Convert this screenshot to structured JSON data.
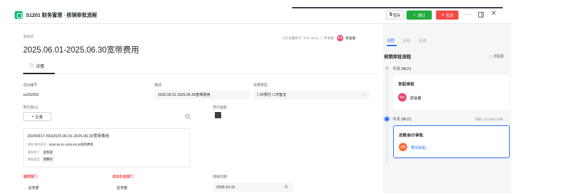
{
  "header": {
    "title": "S1201 财务管理 · 核销审批流程",
    "save_label": "暂存",
    "pass_label": "通过",
    "reject_label": "否决",
    "more_label": "···",
    "close_label": "✕"
  },
  "document": {
    "type_label": "报销单",
    "title": "2025.06.01-2025.06.30宽带费用",
    "meta_updated": "工作流最新于 今天 08:21",
    "meta_applicant_label": "申请者:",
    "meta_applicant_avatar": "郭金",
    "meta_applicant": "郭金春",
    "tab_detail": "详情"
  },
  "fields": {
    "auto_no_label": "自动编号",
    "auto_no_value": "zz202552",
    "desc_label": "描述",
    "desc_value": "2025.06.01-2025.06.30宽带费用",
    "doc_type_label": "单据类型",
    "doc_type_value": "☐冲预付 ☐冲暂支",
    "prepay_label": "预付单(1)",
    "prepay_amount_label": "预付金额",
    "add_record": "记录",
    "card": {
      "title": "20250917-5532025.06.01-2025.06.30宽带费用",
      "row1_label": "请款/请购单号",
      "row1_value": "2025.06.01-2025.06.30宽带费用",
      "row2_label": "请款部门",
      "row2_value": "总务部",
      "row3_label": "请款类型",
      "row3_value": "预算内"
    },
    "apply_dept_label": "请款部门",
    "apply_dept_value": "总务部",
    "cost_dept_label": "成本负担部门",
    "cost_dept_value": "总务部",
    "verify_date_label": "核销日期",
    "verify_date_value": "2025-10-10"
  },
  "side": {
    "tabs": [
      "流程",
      "讨论",
      "日志"
    ],
    "flow_title": "核销审批流程",
    "flowchart_label": "流程图",
    "steps": [
      {
        "time": "今天 08:21",
        "title": "发起审批",
        "avatar": "郭金",
        "name": "郭金春",
        "avatar_color": "#e8456b"
      },
      {
        "time": "今天 08:21",
        "duration": "耗时: 2小时52分钟",
        "title": "总账会计审批",
        "avatar": "总账",
        "name": "等待审批...",
        "avatar_color": "#f76d3c",
        "name_color": "#3370ff"
      }
    ]
  },
  "colors": {
    "accent": "#3370ff",
    "pass": "#21ad3c",
    "reject": "#f54a45",
    "brand": "#00b96b"
  }
}
